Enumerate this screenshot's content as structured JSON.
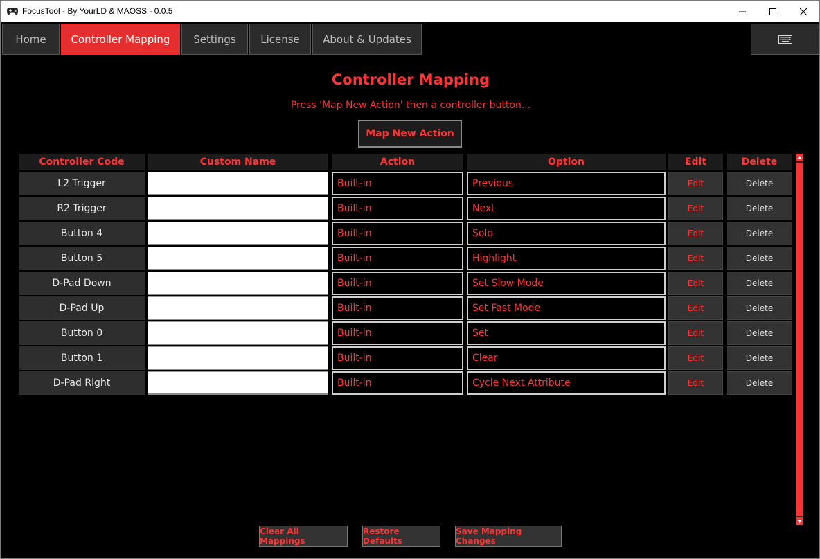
{
  "window": {
    "title": "FocusTool - By YourLD & MAOSS - 0.0.5",
    "app_icon": "gamepad-icon",
    "controls": [
      "minimize-icon",
      "maximize-icon",
      "close-icon"
    ]
  },
  "tabs": [
    {
      "label": "Home",
      "active": false
    },
    {
      "label": "Controller Mapping",
      "active": true
    },
    {
      "label": "Settings",
      "active": false
    },
    {
      "label": "License",
      "active": false
    },
    {
      "label": "About & Updates",
      "active": false
    }
  ],
  "keyboard_button_icon": "keyboard-icon",
  "page": {
    "title": "Controller Mapping",
    "subtitle": "Press 'Map New Action' then a controller button...",
    "map_button": "Map New Action"
  },
  "table": {
    "headers": {
      "code": "Controller Code",
      "name": "Custom Name",
      "action": "Action",
      "option": "Option",
      "edit": "Edit",
      "delete": "Delete"
    },
    "rows": [
      {
        "code": "L2 Trigger",
        "name": "",
        "action": "Built-in",
        "option": "Previous",
        "edit": "Edit",
        "delete": "Delete"
      },
      {
        "code": "R2 Trigger",
        "name": "",
        "action": "Built-in",
        "option": "Next",
        "edit": "Edit",
        "delete": "Delete"
      },
      {
        "code": "Button 4",
        "name": "",
        "action": "Built-in",
        "option": "Solo",
        "edit": "Edit",
        "delete": "Delete"
      },
      {
        "code": "Button 5",
        "name": "",
        "action": "Built-in",
        "option": "Highlight",
        "edit": "Edit",
        "delete": "Delete"
      },
      {
        "code": "D-Pad Down",
        "name": "",
        "action": "Built-in",
        "option": "Set Slow Mode",
        "edit": "Edit",
        "delete": "Delete"
      },
      {
        "code": "D-Pad Up",
        "name": "",
        "action": "Built-in",
        "option": "Set Fast Mode",
        "edit": "Edit",
        "delete": "Delete"
      },
      {
        "code": "Button 0",
        "name": "",
        "action": "Built-in",
        "option": "Set",
        "edit": "Edit",
        "delete": "Delete"
      },
      {
        "code": "Button 1",
        "name": "",
        "action": "Built-in",
        "option": "Clear",
        "edit": "Edit",
        "delete": "Delete"
      },
      {
        "code": "D-Pad Right",
        "name": "",
        "action": "Built-in",
        "option": "Cycle Next  Attribute",
        "edit": "Edit",
        "delete": "Delete"
      }
    ]
  },
  "footer": {
    "clear_all": "Clear All Mappings",
    "restore_defaults": "Restore Defaults",
    "save_changes": "Save Mapping Changes"
  },
  "colors": {
    "accent": "#ff3333",
    "active_tab": "#e62e2e",
    "background": "#000000"
  }
}
